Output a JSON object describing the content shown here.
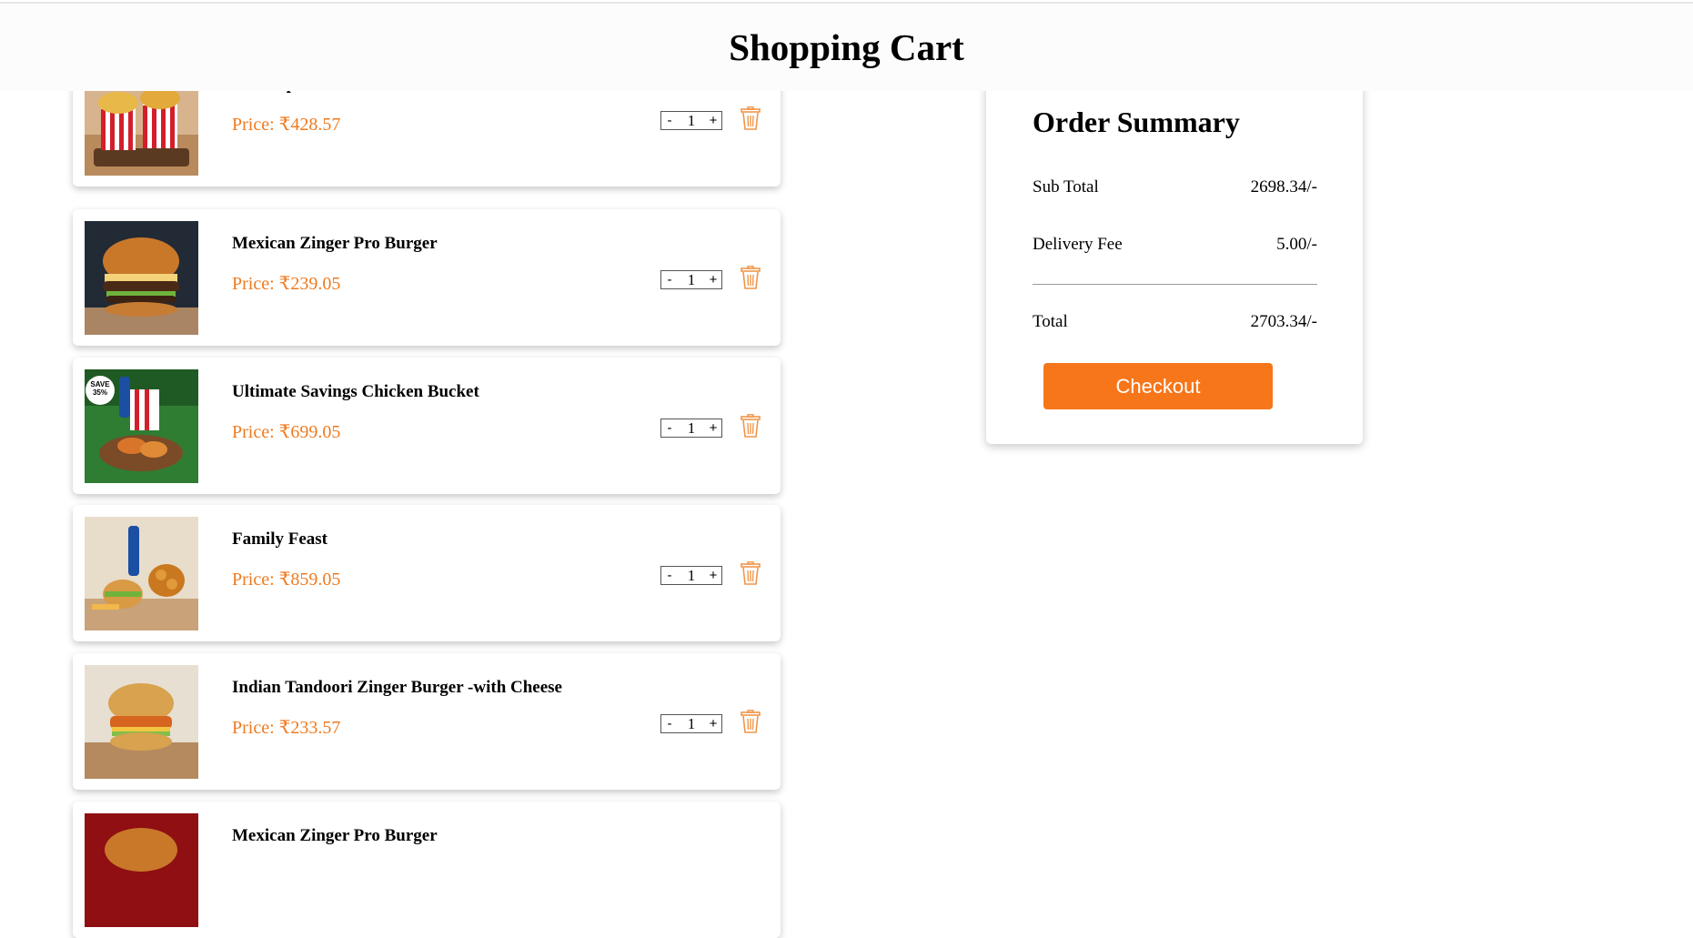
{
  "header": {
    "title": "Shopping Cart"
  },
  "cart": {
    "items": [
      {
        "name": "Duo Popcorn Chicken Rice Bowlz",
        "price": "Price: ₹428.57",
        "qty": "1",
        "minus": "-",
        "plus": "+"
      },
      {
        "name": "Mexican Zinger Pro Burger",
        "price": "Price: ₹239.05",
        "qty": "1",
        "minus": "-",
        "plus": "+"
      },
      {
        "name": "Ultimate Savings Chicken Bucket",
        "price": "Price: ₹699.05",
        "qty": "1",
        "minus": "-",
        "plus": "+",
        "badge": "SAVE 35%"
      },
      {
        "name": "Family Feast",
        "price": "Price: ₹859.05",
        "qty": "1",
        "minus": "-",
        "plus": "+"
      },
      {
        "name": "Indian Tandoori Zinger Burger -with Cheese",
        "price": "Price: ₹233.57",
        "qty": "1",
        "minus": "-",
        "plus": "+"
      },
      {
        "name": "Mexican Zinger Pro Burger",
        "price": "",
        "qty": "",
        "minus": "",
        "plus": ""
      }
    ]
  },
  "summary": {
    "title": "Order Summary",
    "subtotal_label": "Sub Total",
    "subtotal_value": "2698.34/-",
    "delivery_label": "Delivery Fee",
    "delivery_value": "5.00/-",
    "total_label": "Total",
    "total_value": "2703.34/-",
    "checkout_label": "Checkout"
  },
  "colors": {
    "accent": "#f7761a",
    "price": "#f07a1e",
    "trash": "#f0964a"
  },
  "icons": {
    "remove": "trash-icon"
  }
}
